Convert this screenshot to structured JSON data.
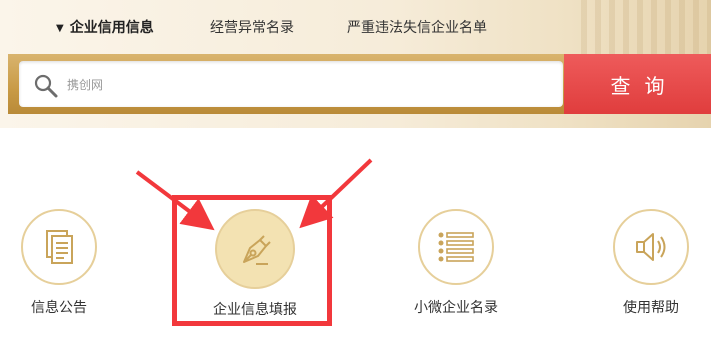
{
  "header": {
    "tabs": [
      {
        "label": "企业信用信息",
        "active": true
      },
      {
        "label": "经营异常名录",
        "active": false
      },
      {
        "label": "严重违法失信企业名单",
        "active": false
      }
    ],
    "active_marker": "▼"
  },
  "search": {
    "value": "",
    "placeholder": "携创网",
    "button_label": "查询"
  },
  "services": [
    {
      "label": "信息公告",
      "icon": "document-icon"
    },
    {
      "label": "企业信息填报",
      "icon": "pen-icon",
      "highlighted": true
    },
    {
      "label": "小微企业名录",
      "icon": "list-icon"
    },
    {
      "label": "使用帮助",
      "icon": "speaker-icon"
    }
  ],
  "colors": {
    "accent_gold": "#c89a45",
    "search_button": "#e84a4a",
    "highlight": "#f2383c",
    "icon_stroke": "#c9a45a"
  }
}
